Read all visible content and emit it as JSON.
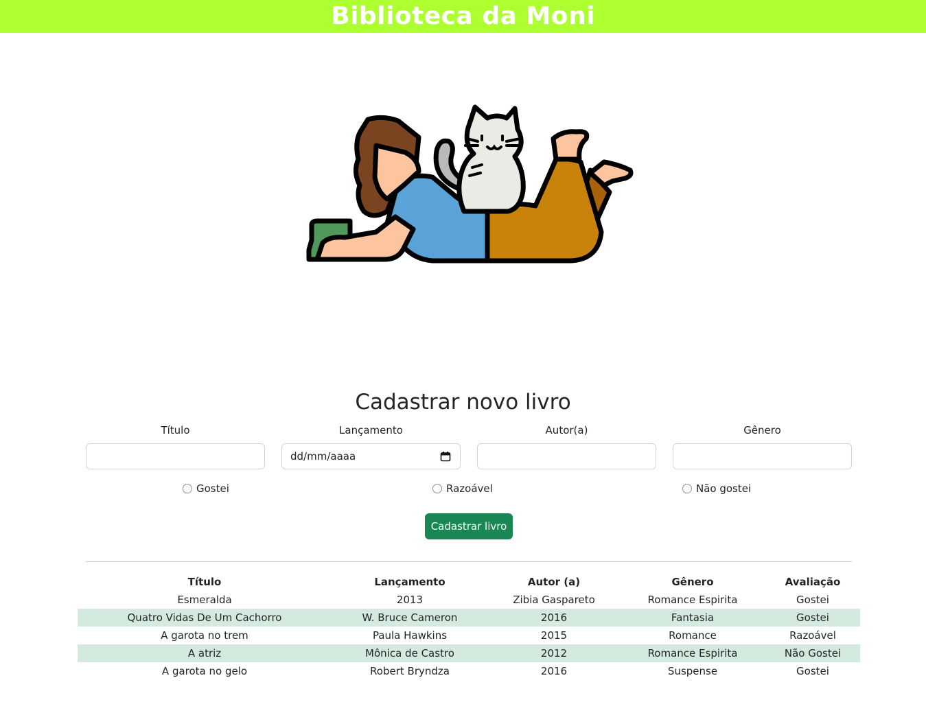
{
  "header": {
    "title": "Biblioteca da Moni"
  },
  "form": {
    "title": "Cadastrar novo livro",
    "fields": [
      {
        "label": "Título",
        "value": "",
        "placeholder": ""
      },
      {
        "label": "Lançamento",
        "value": "",
        "placeholder": "dd/mm/aaaa"
      },
      {
        "label": "Autor(a)",
        "value": "",
        "placeholder": ""
      },
      {
        "label": "Gênero",
        "value": "",
        "placeholder": ""
      }
    ],
    "ratings": [
      "Gostei",
      "Razoável",
      "Não gostei"
    ],
    "submit_label": "Cadastrar livro"
  },
  "table": {
    "headers": [
      "Título",
      "Lançamento",
      "Autor (a)",
      "Gênero",
      "Avaliação"
    ],
    "rows": [
      [
        "Esmeralda",
        "2013",
        "Zibia Gaspareto",
        "Romance Espirita",
        "Gostei"
      ],
      [
        "Quatro Vidas De Um Cachorro",
        "W. Bruce Cameron",
        "2016",
        "Fantasia",
        "Gostei"
      ],
      [
        "A garota no trem",
        "Paula Hawkins",
        "2015",
        "Romance",
        "Razoável"
      ],
      [
        "A atriz",
        "Mônica de Castro",
        "2012",
        "Romance Espirita",
        "Não Gostei"
      ],
      [
        "A garota no gelo",
        "Robert Bryndza",
        "2016",
        "Suspense",
        "Gostei"
      ]
    ]
  },
  "colors": {
    "header_bg": "#adff2f",
    "button_bg": "#198754",
    "stripe_bg": "#d5eadf"
  }
}
